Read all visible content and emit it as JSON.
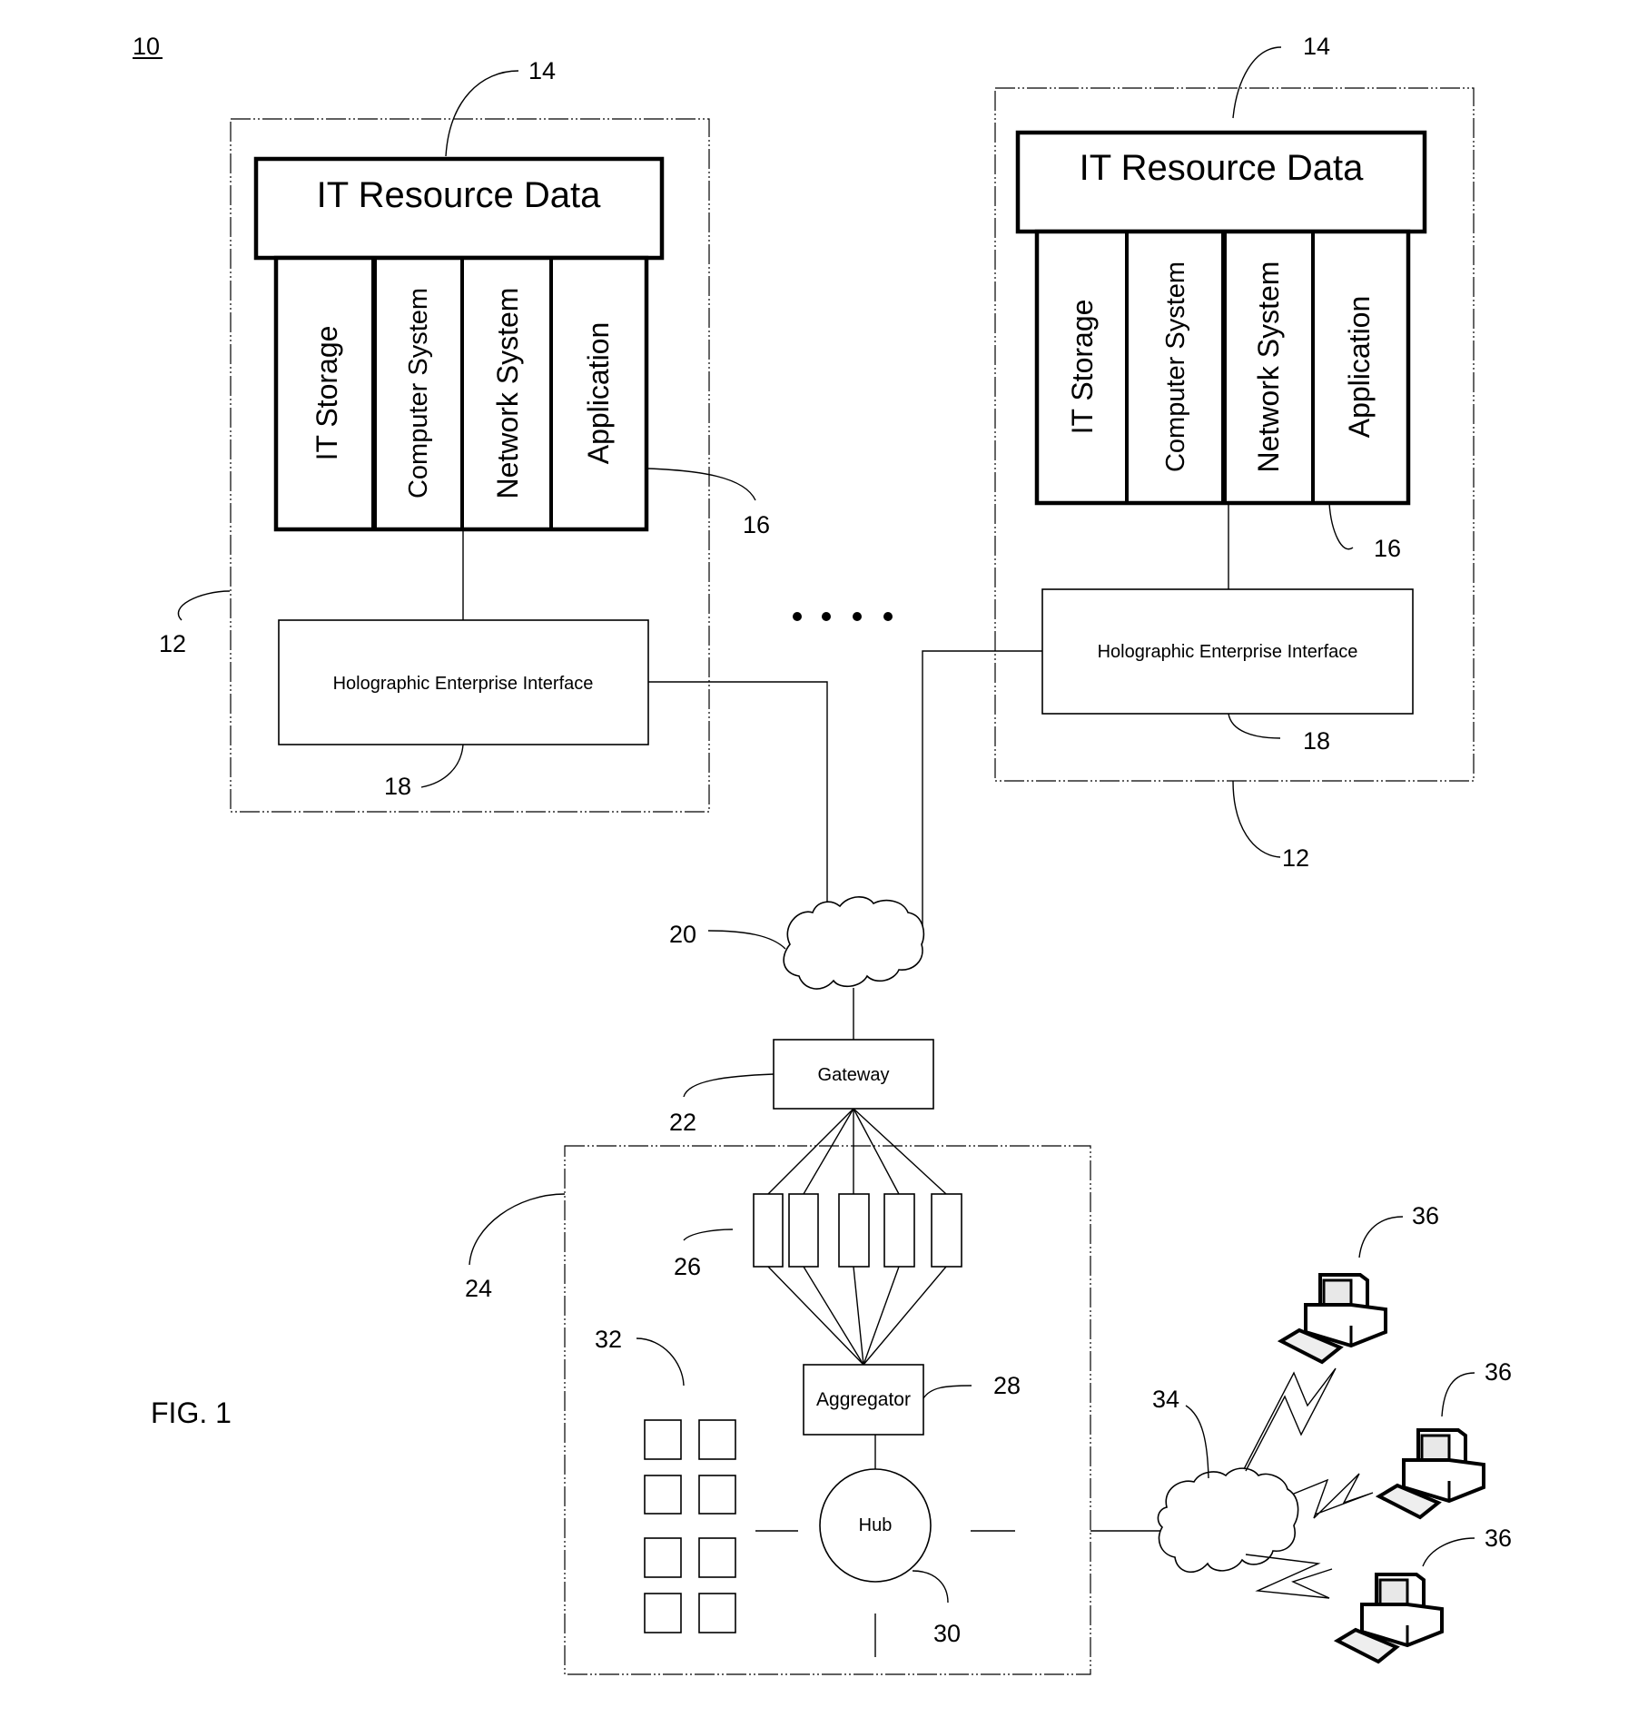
{
  "figure": {
    "title": "FIG. 1",
    "system_ref": "10"
  },
  "enterprises": [
    {
      "ref": "12",
      "it_resource_data": {
        "label": "IT Resource Data",
        "ref": "14"
      },
      "resource_columns": [
        "IT Storage",
        "Computer System",
        "Network System",
        "Application"
      ],
      "columns_ref": "16",
      "interface": {
        "label": "Holographic Enterprise Interface",
        "ref": "18"
      }
    },
    {
      "ref": "12",
      "it_resource_data": {
        "label": "IT Resource Data",
        "ref": "14"
      },
      "resource_columns": [
        "IT Storage",
        "Computer System",
        "Network System",
        "Application"
      ],
      "columns_ref": "16",
      "interface": {
        "label": "Holographic Enterprise Interface",
        "ref": "18"
      }
    }
  ],
  "network": {
    "ref": "20"
  },
  "gateway": {
    "label": "Gateway",
    "ref": "22"
  },
  "hub_site": {
    "ref": "24",
    "processors_ref": "26",
    "processor_count": 5,
    "aggregator": {
      "label": "Aggregator",
      "ref": "28"
    },
    "hub": {
      "label": "Hub",
      "ref": "30"
    },
    "storage_ref": "32",
    "storage_count": 8
  },
  "client_network": {
    "ref": "34"
  },
  "clients": [
    {
      "ref": "36"
    },
    {
      "ref": "36"
    },
    {
      "ref": "36"
    }
  ]
}
